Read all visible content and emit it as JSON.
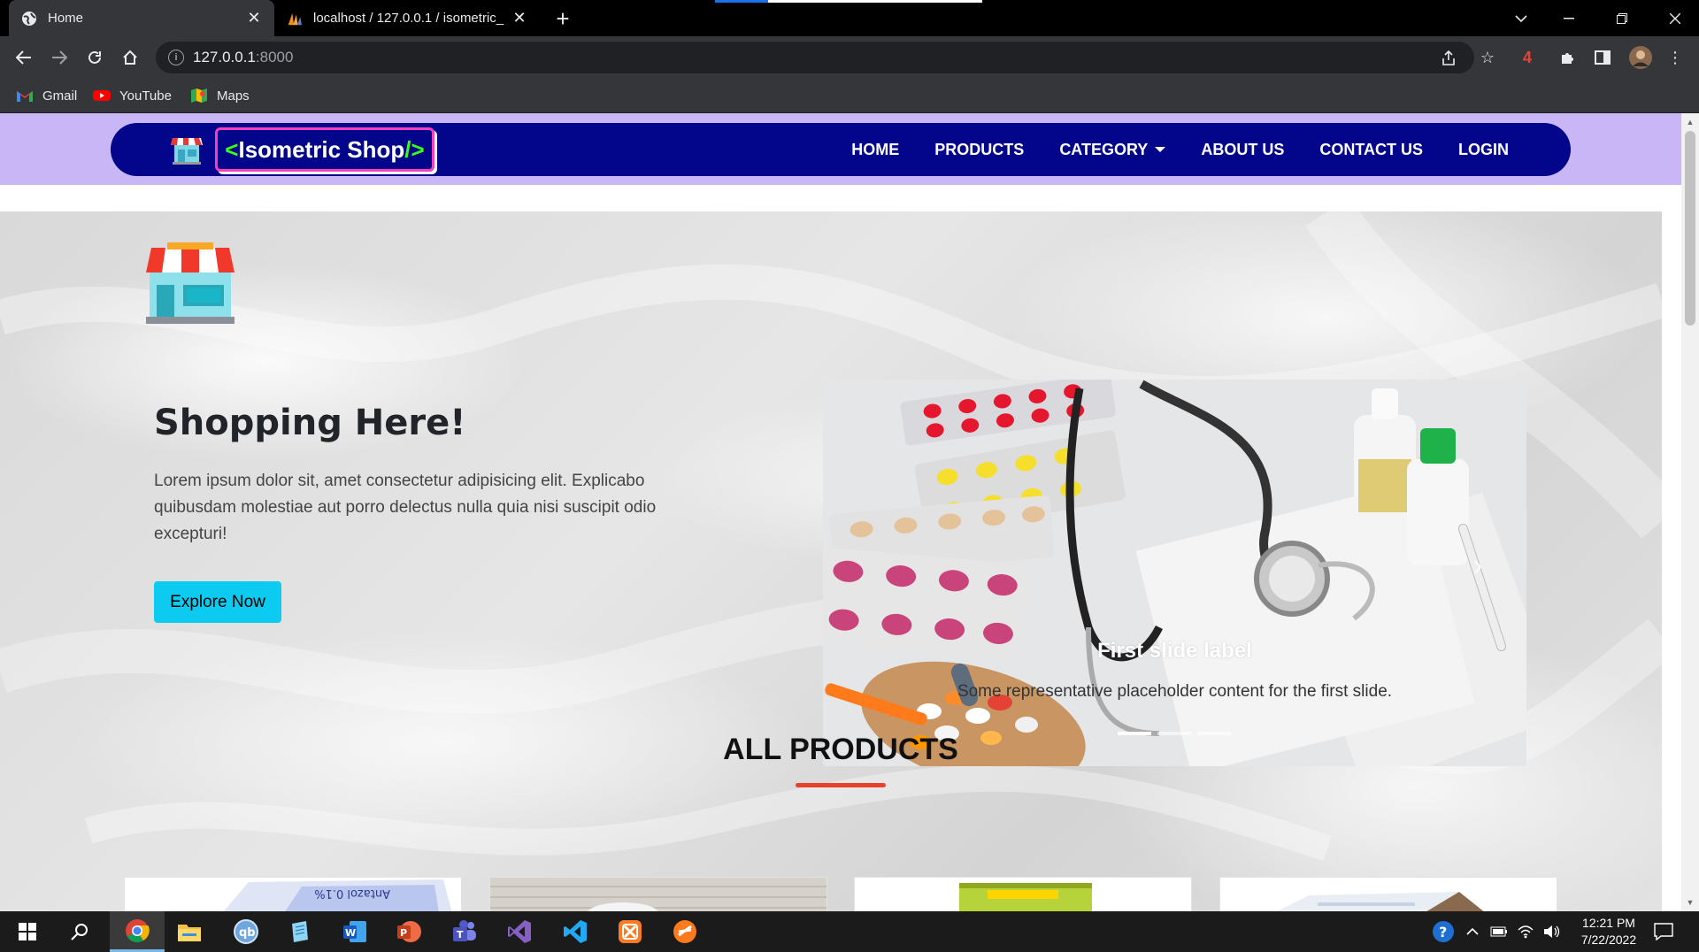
{
  "browser": {
    "tabs": [
      {
        "title": "Home",
        "favicon": "globe-icon",
        "active": true
      },
      {
        "title": "localhost / 127.0.0.1 / isometric_",
        "favicon": "phpmyadmin-icon",
        "active": false
      }
    ],
    "url_host": "127.0.0.1",
    "url_port": ":8000",
    "extension_badge": "4",
    "bookmarks": [
      {
        "label": "Gmail",
        "icon": "gmail-icon"
      },
      {
        "label": "YouTube",
        "icon": "youtube-icon"
      },
      {
        "label": "Maps",
        "icon": "maps-icon"
      }
    ]
  },
  "site": {
    "brand_open": "<",
    "brand_name": "Isometric Shop",
    "brand_close": "/>",
    "nav": {
      "home": "HOME",
      "products": "PRODUCTS",
      "category": "CATEGORY",
      "about": "ABOUT US",
      "contact": "CONTACT US",
      "login": "LOGIN"
    },
    "hero": {
      "title": "Shopping Here!",
      "text": "Lorem ipsum dolor sit, amet consectetur adipisicing elit. Explicabo quibusdam molestiae aut porro delectus nulla quia nisi suscipit odio excepturi!",
      "button": "Explore Now"
    },
    "carousel": {
      "caption_title": "First slide label",
      "caption_text": "Some representative placeholder content for the first slide.",
      "slide_count": 3,
      "active_slide": 1
    },
    "section_title": "ALL PRODUCTS",
    "product_card_count": 4
  },
  "taskbar": {
    "time": "12:21 PM",
    "date": "7/22/2022",
    "apps": [
      "windows-start-icon",
      "search-icon",
      "chrome-icon",
      "file-explorer-icon",
      "qbittorrent-icon",
      "notepad-icon",
      "word-icon",
      "powerpoint-icon",
      "teams-icon",
      "visual-studio-icon",
      "vscode-icon",
      "xampp-icon",
      "sublime-icon"
    ]
  },
  "colors": {
    "nav_bg": "#03058a",
    "nav_strip": "#c9b6f7",
    "brand_border": "#f23fbf",
    "brand_accent": "#39ff14",
    "explore_btn": "#0dcaf0",
    "title_underline": "#e8412b"
  }
}
